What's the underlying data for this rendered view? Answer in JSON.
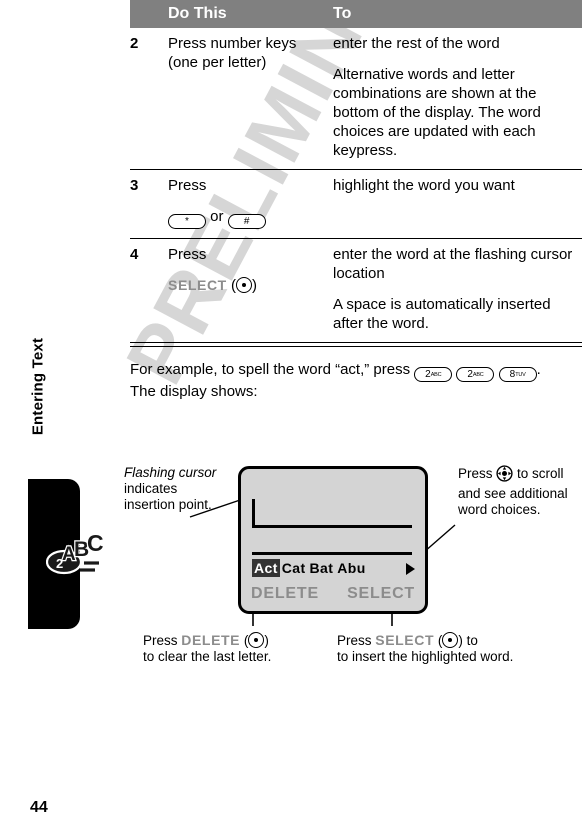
{
  "page": {
    "number": "44",
    "side_title": "Entering Text",
    "watermark": "PRELIMINARY",
    "tab_icon_name": "key-2abc-icon"
  },
  "table": {
    "headers": {
      "num": "",
      "do_this": "Do This",
      "to": "To"
    },
    "rows": [
      {
        "num": "2",
        "do_this_pre": "Press number keys (one per letter)",
        "to": [
          "enter the rest of the word",
          "Alternative words and letter combinations are shown at the bottom of the display. The word choices are updated with each keypress."
        ]
      },
      {
        "num": "3",
        "do_this_pre": "Press",
        "key_star_digit": "*",
        "or_word": "or",
        "key_pound_digit": "#",
        "to": [
          "highlight the word you want"
        ]
      },
      {
        "num": "4",
        "do_this_pre": "Press",
        "softkey_label": "SELECT",
        "to": [
          "enter the word at the flashing cursor location",
          "A space is automatically inserted after the word."
        ]
      }
    ]
  },
  "example": {
    "text_before": "For example, to spell the word “act,” press",
    "keys": [
      {
        "digit": "2",
        "letters": "ABC"
      },
      {
        "digit": "2",
        "letters": "ABC"
      },
      {
        "digit": "8",
        "letters": "TUV"
      }
    ],
    "text_after": ".",
    "line2": "The display shows:"
  },
  "figure": {
    "display": {
      "words": [
        {
          "text": "Act",
          "selected": true
        },
        {
          "text": "Cat",
          "selected": false
        },
        {
          "text": "Bat",
          "selected": false
        },
        {
          "text": "Abu",
          "selected": false
        }
      ],
      "softkey_left": "DELETE",
      "softkey_right": "SELECT",
      "scroll_arrow": "right-triangle-icon"
    },
    "callouts": {
      "cursor_italic": "Flashing cursor",
      "cursor_rest": " indicates insertion point.",
      "scroll_before": "Press",
      "scroll_after": "to scroll and see additional word choices.",
      "delete_before": "Press",
      "delete_label": "DELETE",
      "delete_after": "to clear the last letter.",
      "select_before": "Press",
      "select_label": "SELECT",
      "select_after": "to insert the highlighted word."
    }
  },
  "colors": {
    "header_bg": "#808080",
    "display_bg": "#d4d4d4",
    "softkey_gray": "#8c8c8c",
    "watermark_gray": "#d6d6d6",
    "highlight_bg": "#333333"
  }
}
